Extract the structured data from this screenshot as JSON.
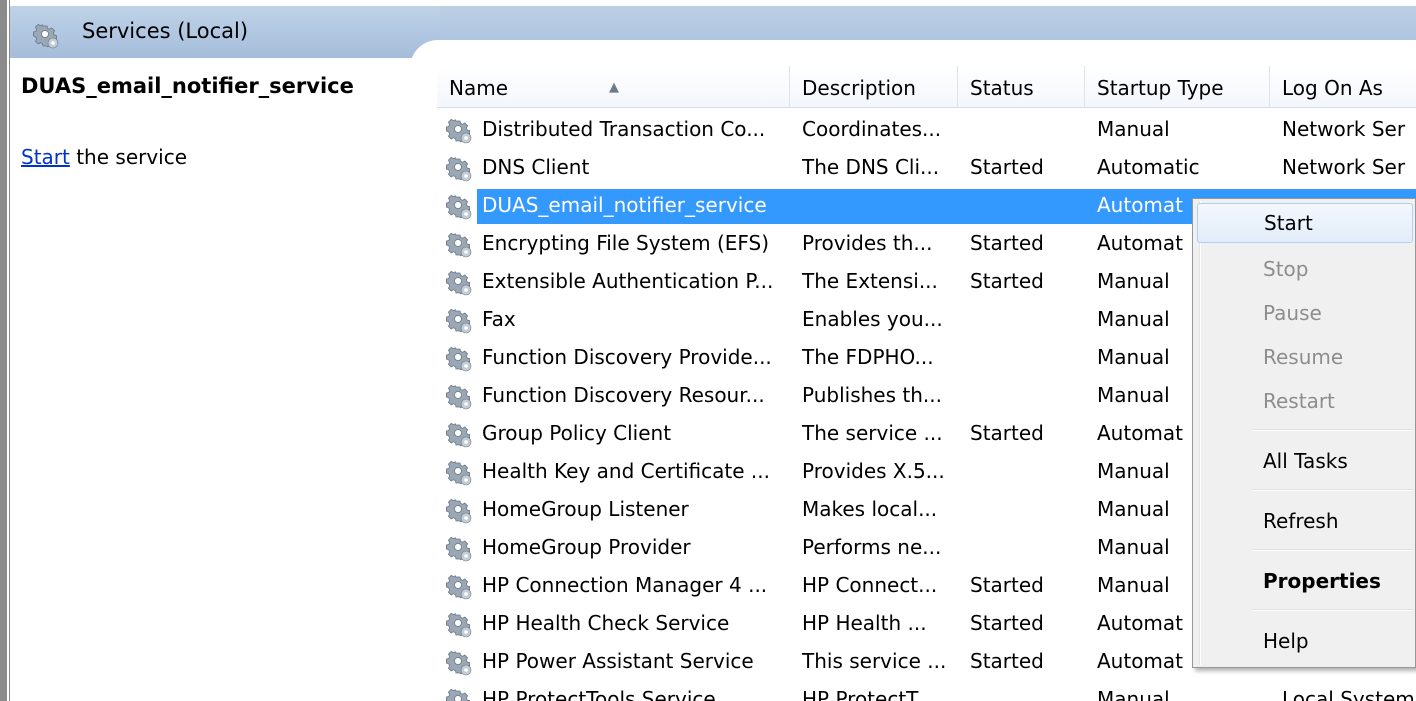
{
  "header": {
    "title": "Services (Local)",
    "icon": "gear-icon"
  },
  "detail": {
    "service_name": "DUAS_email_notifier_service",
    "action_link": "Start",
    "action_text": " the service"
  },
  "columns": [
    "Name",
    "Description",
    "Status",
    "Startup Type",
    "Log On As"
  ],
  "rows": [
    {
      "name": "Distributed Transaction Co...",
      "description": "Coordinates...",
      "status": "",
      "startup": "Manual",
      "logon": "Network Ser"
    },
    {
      "name": "DNS Client",
      "description": "The DNS Cli...",
      "status": "Started",
      "startup": "Automatic",
      "logon": "Network Ser"
    },
    {
      "name": "DUAS_email_notifier_service",
      "description": "",
      "status": "",
      "startup": "Automat",
      "logon": ""
    },
    {
      "name": "Encrypting File System (EFS)",
      "description": "Provides th...",
      "status": "Started",
      "startup": "Automat",
      "logon": ""
    },
    {
      "name": "Extensible Authentication P...",
      "description": "The Extensi...",
      "status": "Started",
      "startup": "Manual",
      "logon": ""
    },
    {
      "name": "Fax",
      "description": "Enables you...",
      "status": "",
      "startup": "Manual",
      "logon": ""
    },
    {
      "name": "Function Discovery Provide...",
      "description": "The FDPHO...",
      "status": "",
      "startup": "Manual",
      "logon": ""
    },
    {
      "name": "Function Discovery Resour...",
      "description": "Publishes th...",
      "status": "",
      "startup": "Manual",
      "logon": ""
    },
    {
      "name": "Group Policy Client",
      "description": "The service ...",
      "status": "Started",
      "startup": "Automat",
      "logon": ""
    },
    {
      "name": "Health Key and Certificate ...",
      "description": "Provides X.5...",
      "status": "",
      "startup": "Manual",
      "logon": ""
    },
    {
      "name": "HomeGroup Listener",
      "description": "Makes local...",
      "status": "",
      "startup": "Manual",
      "logon": ""
    },
    {
      "name": "HomeGroup Provider",
      "description": "Performs ne...",
      "status": "",
      "startup": "Manual",
      "logon": ""
    },
    {
      "name": "HP Connection Manager 4 ...",
      "description": "HP Connect...",
      "status": "Started",
      "startup": "Manual",
      "logon": ""
    },
    {
      "name": "HP Health Check Service",
      "description": "HP Health ...",
      "status": "Started",
      "startup": "Automat",
      "logon": ""
    },
    {
      "name": "HP Power Assistant Service",
      "description": "This service ...",
      "status": "Started",
      "startup": "Automat",
      "logon": ""
    },
    {
      "name": "HP ProtectTools Service",
      "description": "HP ProtectT...",
      "status": "",
      "startup": "Manual",
      "logon": "Local System"
    }
  ],
  "selected_row": 2,
  "context_menu": [
    {
      "label": "Start",
      "state": "hover"
    },
    {
      "label": "Stop",
      "state": "disabled"
    },
    {
      "label": "Pause",
      "state": "disabled"
    },
    {
      "label": "Resume",
      "state": "disabled"
    },
    {
      "label": "Restart",
      "state": "disabled"
    },
    {
      "label": "All Tasks",
      "state": "normal"
    },
    {
      "label": "Refresh",
      "state": "normal"
    },
    {
      "label": "Properties",
      "state": "bold"
    },
    {
      "label": "Help",
      "state": "normal"
    }
  ],
  "colors": {
    "selection": "#3399ff",
    "header": "#bccfe6",
    "link": "#0033cc"
  }
}
